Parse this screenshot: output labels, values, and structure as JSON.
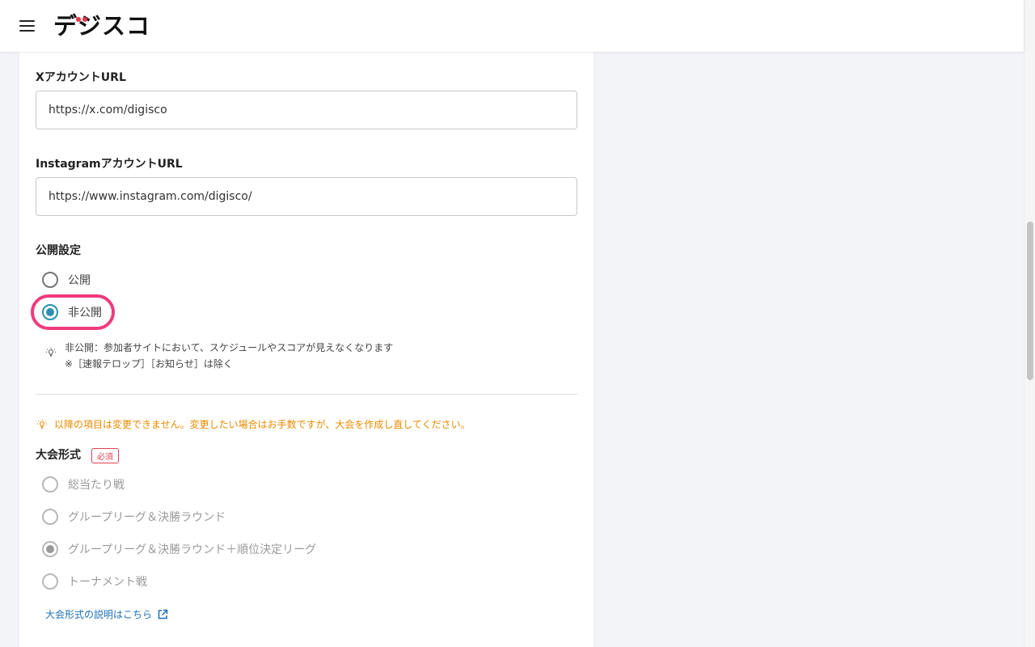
{
  "header": {
    "logo_text": "デジスコ",
    "menu_icon": "hamburger-menu-icon",
    "logo_accent_color": "#e8334a"
  },
  "form": {
    "x_account": {
      "label": "XアカウントURL",
      "value": "https://x.com/digisco"
    },
    "instagram_account": {
      "label": "InstagramアカウントURL",
      "value": "https://www.instagram.com/digisco/"
    },
    "visibility": {
      "label": "公開設定",
      "options": [
        "公開",
        "非公開"
      ],
      "selected": "非公開",
      "hint_line1": "非公開：参加者サイトにおいて、スケジュールやスコアが見えなくなります",
      "hint_line2": "※［速報テロップ］［お知らせ］は除く"
    },
    "warning": "以降の項目は変更できません。変更したい場合はお手数ですが、大会を作成し直してください。",
    "format": {
      "label": "大会形式",
      "required_badge": "必須",
      "options": [
        "総当たり戦",
        "グループリーグ＆決勝ラウンド",
        "グループリーグ＆決勝ラウンド＋順位決定リーグ",
        "トーナメント戦"
      ],
      "selected": "グループリーグ＆決勝ラウンド＋順位決定リーグ",
      "disabled": true,
      "help_link": "大会形式の説明はこちら"
    }
  },
  "colors": {
    "accent": "#2e8fb0",
    "highlight": "#ef3b7d",
    "warning": "#e88a00",
    "link": "#1c6fb8",
    "required": "#e34050"
  }
}
